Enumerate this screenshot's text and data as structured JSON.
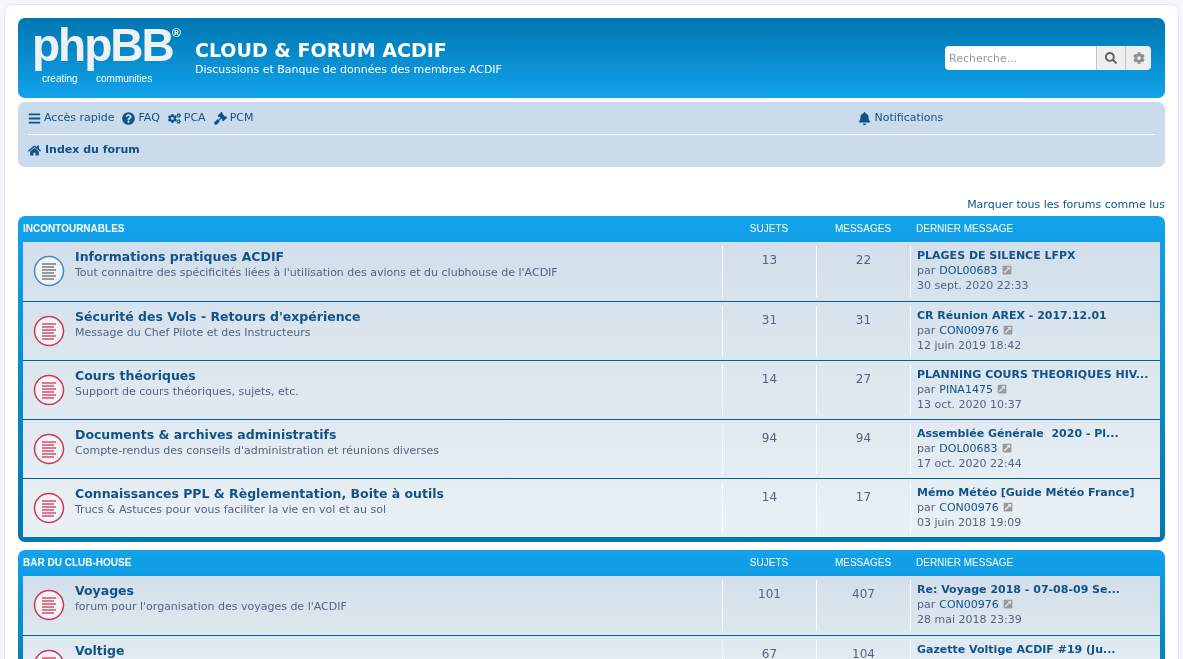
{
  "header": {
    "logo": {
      "word": "phpBB",
      "mark": "®",
      "tagline_left": "creating",
      "tagline_right": "communities"
    },
    "site_title": "CLOUD & FORUM ACDIF",
    "site_description": "Discussions et Banque de données des membres ACDIF",
    "search": {
      "placeholder": "Recherche..."
    }
  },
  "navbar": {
    "links": [
      {
        "kind": "menu",
        "label": "Accès rapide"
      },
      {
        "kind": "faq",
        "label": "FAQ"
      },
      {
        "kind": "acp",
        "label": "PCA"
      },
      {
        "kind": "mcp",
        "label": "PCM"
      }
    ],
    "notifications": "Notifications",
    "breadcrumb": "Index du forum"
  },
  "mark_all_read": "Marquer tous les forums comme lus",
  "categories": [
    {
      "title": "INCONTOURNABLES",
      "columns": [
        "SUJETS",
        "MESSAGES",
        "DERNIER MESSAGE"
      ],
      "forums": [
        {
          "title": "Informations pratiques ACDIF",
          "description": "Tout connaitre des spécificités liées à l'utilisation des avions et du clubhouse de l'ACDIF",
          "unread": false,
          "topics": "13",
          "posts": "22",
          "last_post": {
            "title": "PLAGES DE SILENCE LFPX",
            "by": "par",
            "author": "DOL00683",
            "time": "30 sept. 2020 22:33"
          }
        },
        {
          "title": "Sécurité des Vols - Retours d'expérience",
          "description": "Message du Chef Pilote et des Instructeurs",
          "unread": true,
          "topics": "31",
          "posts": "31",
          "last_post": {
            "title": "CR Réunion AREX - 2017.12.01",
            "by": "par",
            "author": "CON00976",
            "time": "12 juin 2019 18:42"
          }
        },
        {
          "title": "Cours théoriques",
          "description": "Support de cours théoriques, sujets, etc.",
          "unread": true,
          "topics": "14",
          "posts": "27",
          "last_post": {
            "title": "PLANNING COURS THEORIQUES HIV...",
            "by": "par",
            "author": "PINA1475",
            "time": "13 oct. 2020 10:37"
          }
        },
        {
          "title": "Documents & archives administratifs",
          "description": "Compte-rendus des conseils d'administration et réunions diverses",
          "unread": true,
          "topics": "94",
          "posts": "94",
          "last_post": {
            "title": "Assemblée Générale  2020 - Pl...",
            "by": "par",
            "author": "DOL00683",
            "time": "17 oct. 2020 22:44"
          }
        },
        {
          "title": "Connaissances PPL & Règlementation, Boite à outils",
          "description": "Trucs & Astuces pour vous faciliter la vie en vol et au sol",
          "unread": true,
          "topics": "14",
          "posts": "17",
          "last_post": {
            "title": "Mémo Météo [Guide Météo France]",
            "by": "par",
            "author": "CON00976",
            "time": "03 juin 2018 19:09"
          }
        }
      ]
    },
    {
      "title": "BAR DU CLUB-HOUSE",
      "columns": [
        "SUJETS",
        "MESSAGES",
        "DERNIER MESSAGE"
      ],
      "forums": [
        {
          "title": "Voyages",
          "description": "forum pour l'organisation des voyages de l'ACDIF",
          "unread": true,
          "topics": "101",
          "posts": "407",
          "last_post": {
            "title": "Re: Voyage 2018 - 07-08-09 Se...",
            "by": "par",
            "author": "CON00976",
            "time": "28 mai 2018 23:39"
          }
        },
        {
          "title": "Voltige",
          "unread": true,
          "topics": "67",
          "posts": "104",
          "last_post": {
            "title": "Gazette Voltige ACDIF #19 (Ju..."
          }
        }
      ]
    }
  ]
}
